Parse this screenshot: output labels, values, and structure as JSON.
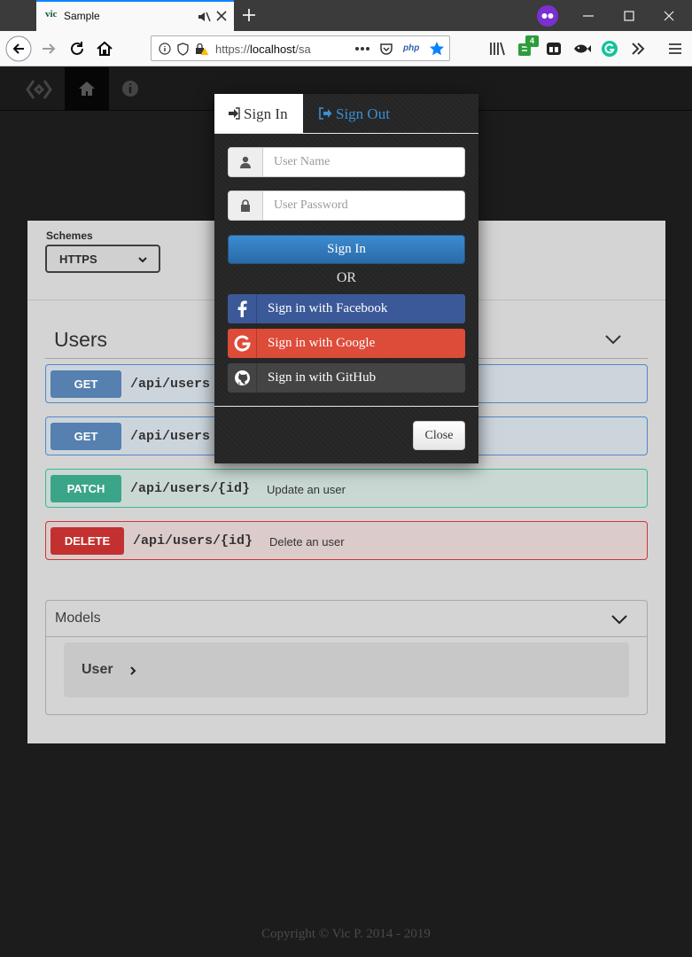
{
  "browser": {
    "tab_title": "Sample",
    "tab_favicon_text": "vic",
    "url_scheme": "https://",
    "url_host": "localhost",
    "url_rest": "/sa",
    "ext_badge_count": "4",
    "php_label": "php"
  },
  "api": {
    "schemes_label": "Schemes",
    "schemes_value": "HTTPS",
    "section_title": "Users",
    "operations": [
      {
        "method": "GET",
        "path": "/api/users",
        "summary": ""
      },
      {
        "method": "GET",
        "path": "/api/users",
        "summary": ""
      },
      {
        "method": "PATCH",
        "path": "/api/users/{id}",
        "summary": "Update an user"
      },
      {
        "method": "DELETE",
        "path": "/api/users/{id}",
        "summary": "Delete an user"
      }
    ],
    "models_title": "Models",
    "model_user": "User"
  },
  "footer": {
    "copyright": "Copyright © Vic P. 2014 - 2019"
  },
  "modal": {
    "tab_signin": "Sign In",
    "tab_signout": "Sign Out",
    "username_placeholder": "User Name",
    "password_placeholder": "User Password",
    "signin_button": "Sign In",
    "or_text": "OR",
    "facebook_button": "Sign in with Facebook",
    "google_button": "Sign in with Google",
    "github_button": "Sign in with GitHub",
    "close_button": "Close"
  },
  "colors": {
    "facebook": "#3b5998",
    "google": "#dd4b39",
    "github": "#444444",
    "signout_link": "#3a8fd8",
    "get": "#5580b0",
    "patch": "#3aa589",
    "delete": "#c23030"
  },
  "icons": {
    "browser": [
      "back-icon",
      "forward-icon",
      "reload-icon",
      "home-icon",
      "info-icon",
      "shield-icon",
      "lock-warning-icon",
      "more-icon",
      "pocket-icon",
      "bookmark-star-icon",
      "library-icon",
      "extension-icon",
      "grammarly-icon",
      "overflow-icon",
      "menu-icon"
    ],
    "app": [
      "logo-icon",
      "home-icon",
      "info-icon"
    ],
    "modal": [
      "sign-in-icon",
      "sign-out-icon",
      "user-icon",
      "lock-icon",
      "facebook-icon",
      "google-icon",
      "github-icon"
    ]
  }
}
